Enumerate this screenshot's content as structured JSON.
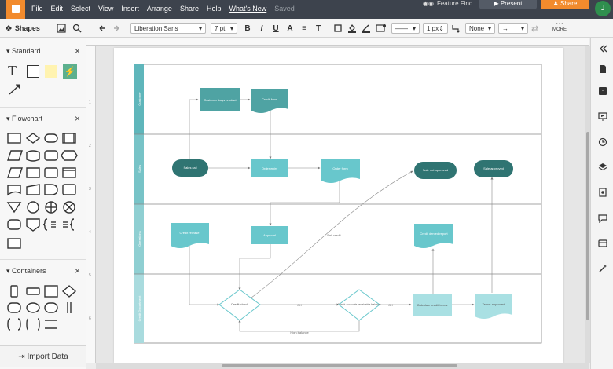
{
  "menubar": {
    "items": [
      "File",
      "Edit",
      "Select",
      "View",
      "Insert",
      "Arrange",
      "Share",
      "Help",
      "What's New"
    ],
    "saved_status": "Saved",
    "feature_find": "Feature Find",
    "present_label": "Present",
    "share_label": "Share",
    "avatar_initial": "J"
  },
  "toolbar": {
    "shapes_label": "Shapes",
    "font": "Liberation Sans",
    "font_size": "7 pt",
    "line_width": "1 px",
    "line_end": "None",
    "more_label": "MORE"
  },
  "leftpanel": {
    "standard_title": "Standard",
    "flowchart_title": "Flowchart",
    "containers_title": "Containers",
    "import_label": "Import Data"
  },
  "ruler": {
    "left_numbers": [
      "1",
      "2",
      "3",
      "4",
      "5",
      "6"
    ]
  },
  "diagram": {
    "lanes": [
      "Customer",
      "Sales",
      "Operations",
      "Credit Department"
    ],
    "nodes": {
      "customer_purchase": "Customer buys product",
      "credit_form_top": "Credit form",
      "sales_call": "Sales call",
      "order_entry": "Order entry",
      "order_form": "Order form",
      "sale_not_approved": "Sale not approved",
      "sale_approved": "Sale approved",
      "credit_release": "Credit release",
      "approval": "Approval",
      "credit_denied_report": "Credit denied report",
      "credit_check": "Credit check",
      "check_balance": "Check accounts receivable balance",
      "calculate_credit": "Calculate credit terms",
      "terms_approved": "Terms approved"
    },
    "edge_labels": {
      "fail": "Fail credit",
      "ok1": "OK",
      "ok2": "OK",
      "high_balance": "High balance"
    }
  },
  "colors": {
    "menubar": "#3d434d",
    "accent_orange": "#f28b2d",
    "node_teal": "#4fa3a3",
    "node_light": "#68c7cc",
    "node_dark": "#2f7472",
    "lane_header": "#5fb6bb"
  }
}
